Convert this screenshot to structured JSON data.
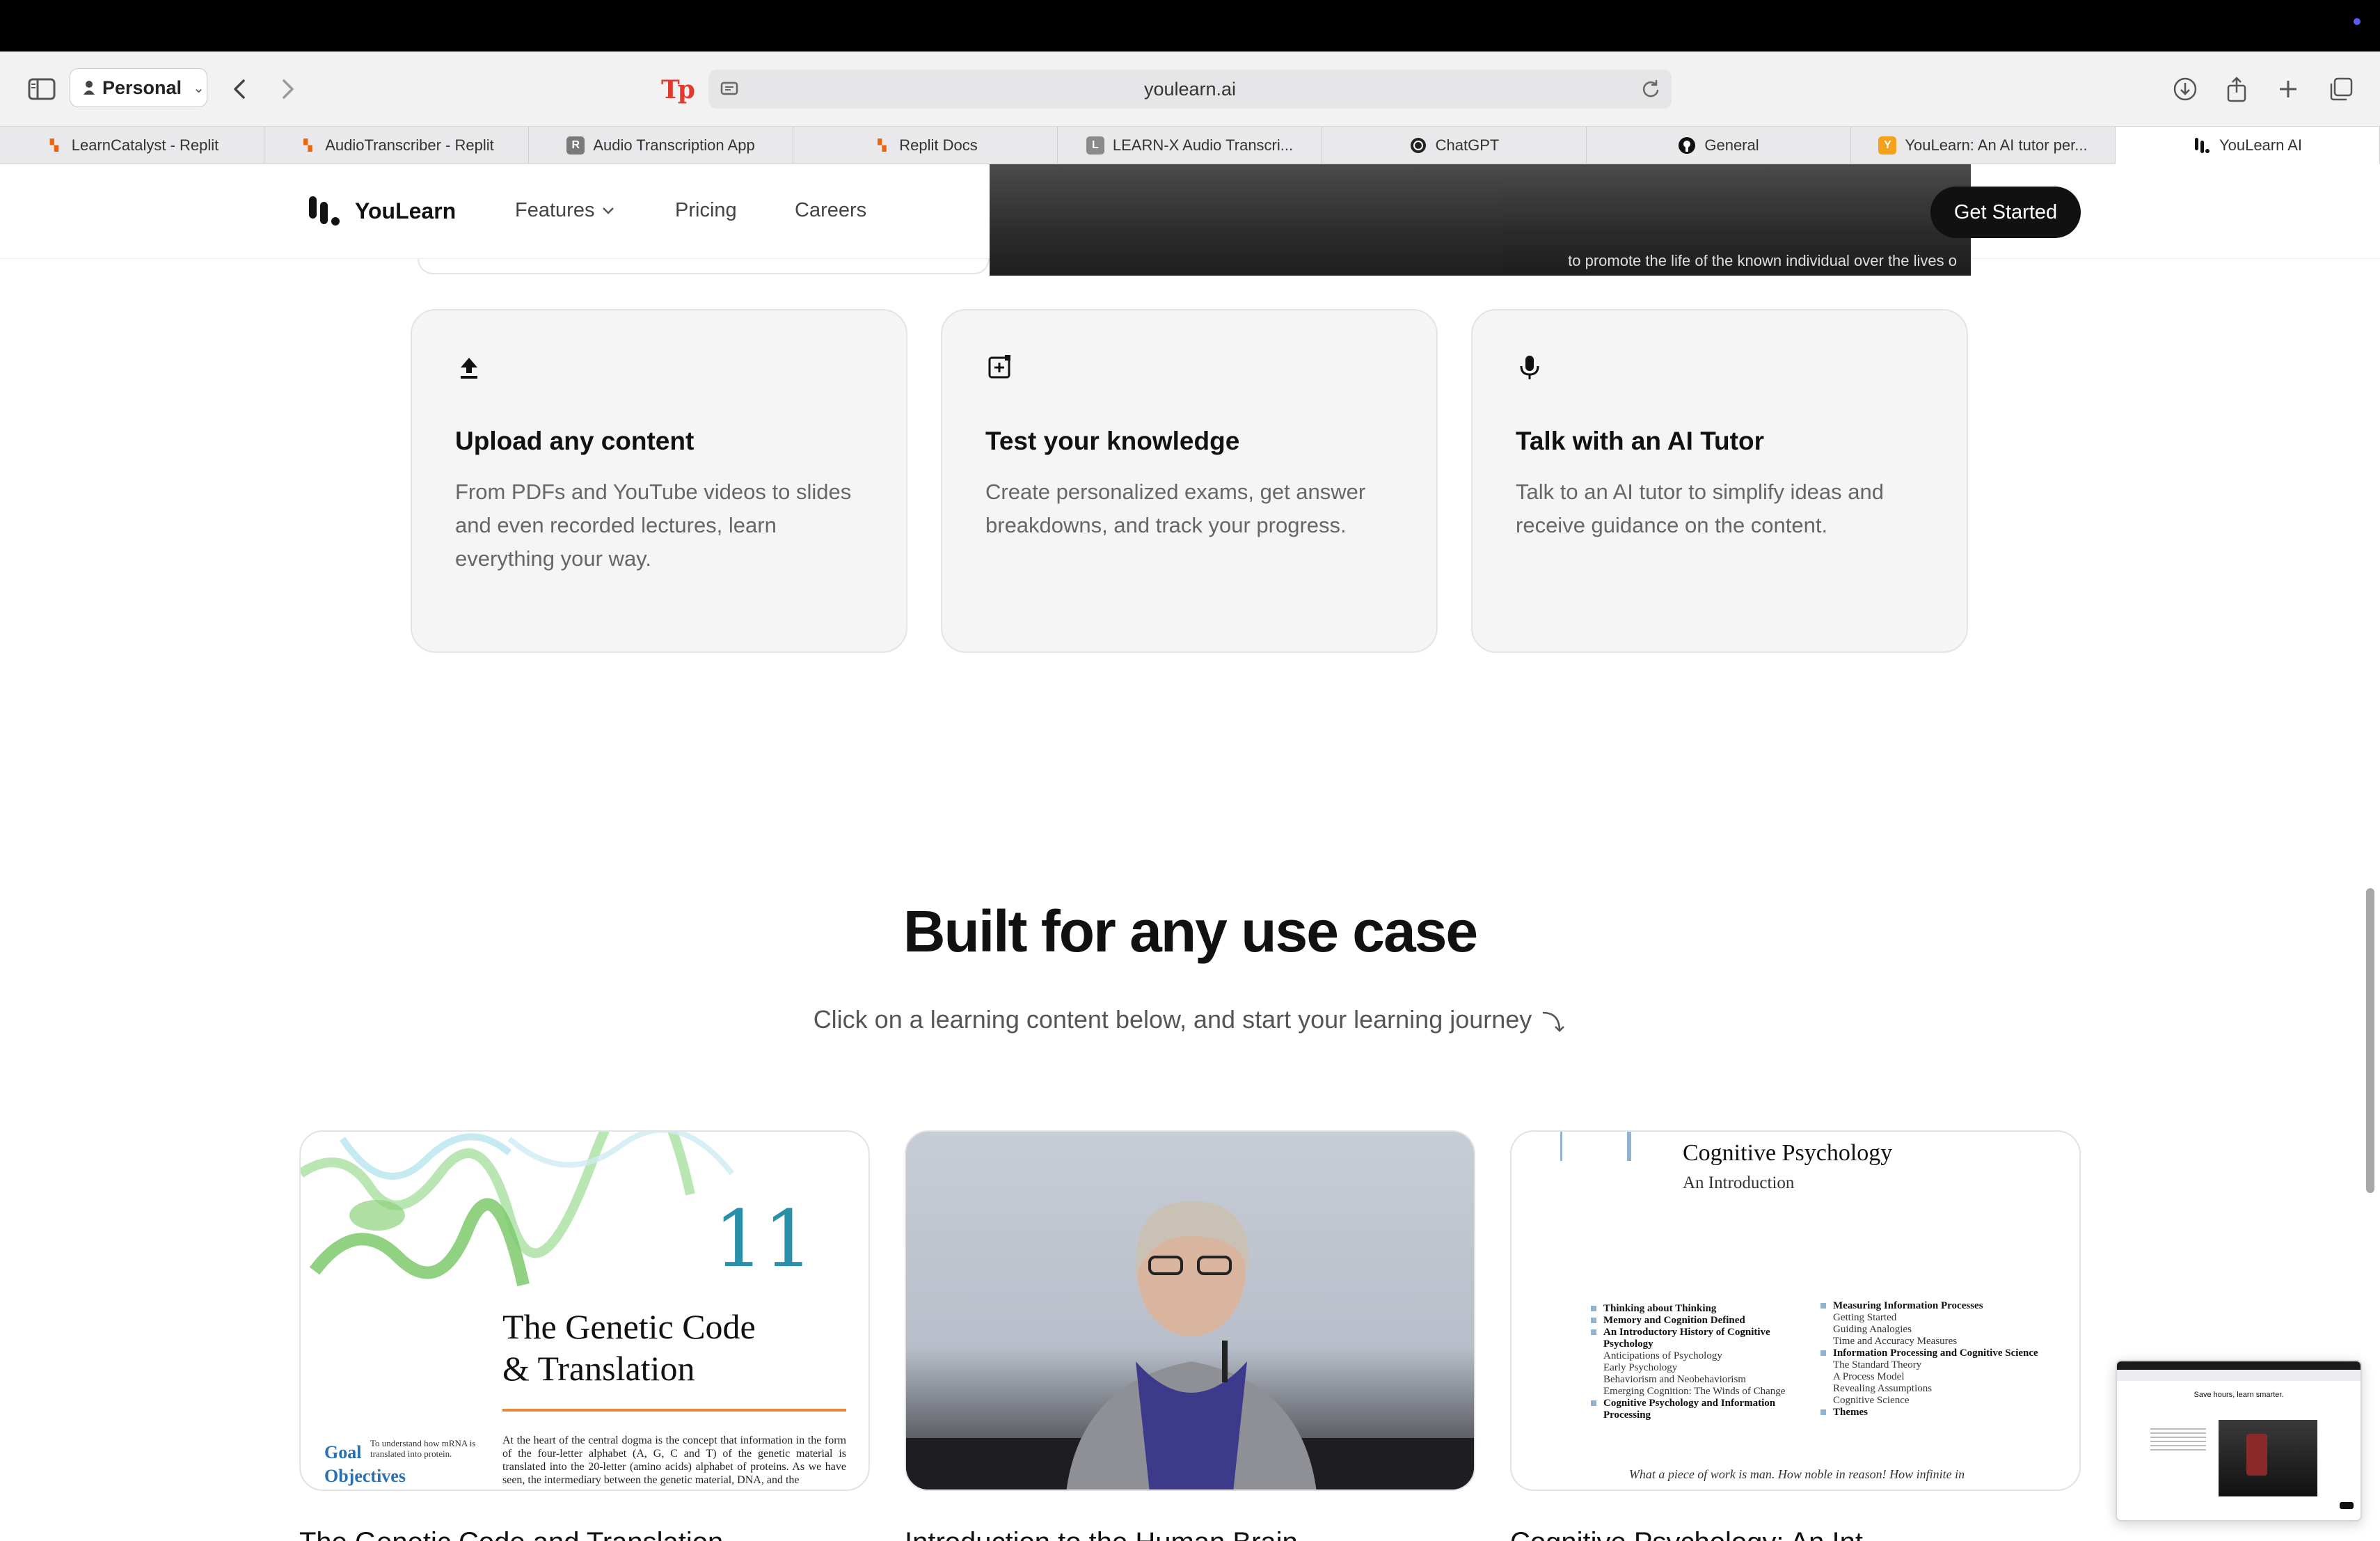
{
  "browser": {
    "profile_label": "Personal",
    "url": "youlearn.ai",
    "tabs": [
      {
        "label": "LearnCatalyst - Replit",
        "icon": "replit-icon",
        "icon_color": "#f26207",
        "active": false
      },
      {
        "label": "AudioTranscriber - Replit",
        "icon": "replit-icon",
        "icon_color": "#f26207",
        "active": false
      },
      {
        "label": "Audio Transcription App",
        "icon": "r-badge-icon",
        "icon_color": "#7a7a7a",
        "active": false
      },
      {
        "label": "Replit Docs",
        "icon": "replit-icon",
        "icon_color": "#f26207",
        "active": false
      },
      {
        "label": "LEARN-X Audio Transcri...",
        "icon": "l-badge-icon",
        "icon_color": "#8a8a8a",
        "active": false
      },
      {
        "label": "ChatGPT",
        "icon": "openai-icon",
        "icon_color": "#222222",
        "active": false
      },
      {
        "label": "General",
        "icon": "github-icon",
        "icon_color": "#111111",
        "active": false
      },
      {
        "label": "YouLearn: An AI tutor per...",
        "icon": "y-badge-icon",
        "icon_color": "#f4a21b",
        "active": false
      },
      {
        "label": "YouLearn AI",
        "icon": "youlearn-icon",
        "icon_color": "#111111",
        "active": true
      }
    ]
  },
  "site": {
    "brand": "YouLearn",
    "nav": {
      "features": "Features",
      "pricing": "Pricing",
      "careers": "Careers",
      "cta": "Get Started"
    },
    "video_caption": "to promote the life of the known individual over the lives o"
  },
  "features": [
    {
      "icon": "upload-icon",
      "title": "Upload any content",
      "desc": "From PDFs and YouTube videos to slides and even recorded lectures, learn everything your way."
    },
    {
      "icon": "exam-plus-icon",
      "title": "Test your knowledge",
      "desc": "Create personalized exams, get answer breakdowns, and track your progress."
    },
    {
      "icon": "microphone-icon",
      "title": "Talk with an AI Tutor",
      "desc": "Talk to an AI tutor to simplify ideas and receive guidance on the content."
    }
  ],
  "use_case": {
    "title": "Built for any use case",
    "subtitle": "Click on a learning content below, and start your learning journey",
    "items": [
      {
        "title": "The Genetic Code and Translation",
        "doc_number": "11",
        "doc_title_line1": "The Genetic Code",
        "doc_title_line2": "& Translation",
        "goal_label": "Goal",
        "goal_text": "To understand how mRNA is translated into protein.",
        "objectives_label": "Objectives",
        "body": "At the heart of the central dogma is the concept that information in the form of the four-letter alphabet (A, G, C and T) of the genetic material is translated into the 20-letter (amino acids) alphabet of proteins. As we have seen, the intermediary between the genetic material, DNA, and the"
      },
      {
        "title": "Introduction to the Human Brain"
      },
      {
        "title": "Cognitive Psychology: An Int",
        "doc_title": "Cognitive Psychology",
        "doc_subtitle": "An Introduction",
        "toc_left": [
          {
            "text": "Thinking about Thinking",
            "bold": true
          },
          {
            "text": "Memory and Cognition Defined",
            "bold": true
          },
          {
            "text": "An Introductory History of Cognitive Psychology",
            "bold": true
          },
          {
            "text": "Anticipations of Psychology",
            "bold": false
          },
          {
            "text": "Early Psychology",
            "bold": false
          },
          {
            "text": "Behaviorism and Neobehaviorism",
            "bold": false
          },
          {
            "text": "Emerging Cognition: The Winds of Change",
            "bold": false
          },
          {
            "text": "Cognitive Psychology and Information Processing",
            "bold": true
          }
        ],
        "toc_right": [
          {
            "text": "Measuring Information Processes",
            "bold": true
          },
          {
            "text": "Getting Started",
            "bold": false
          },
          {
            "text": "Guiding Analogies",
            "bold": false
          },
          {
            "text": "Time and Accuracy Measures",
            "bold": false
          },
          {
            "text": "Information Processing and Cognitive Science",
            "bold": true
          },
          {
            "text": "The Standard Theory",
            "bold": false
          },
          {
            "text": "A Process Model",
            "bold": false
          },
          {
            "text": "Revealing Assumptions",
            "bold": false
          },
          {
            "text": "Cognitive Science",
            "bold": false
          },
          {
            "text": "Themes",
            "bold": true
          }
        ],
        "quote": "What a piece of work is man. How noble in reason! How infinite in"
      }
    ]
  },
  "mini_preview": {
    "title": "Save hours, learn smarter."
  }
}
